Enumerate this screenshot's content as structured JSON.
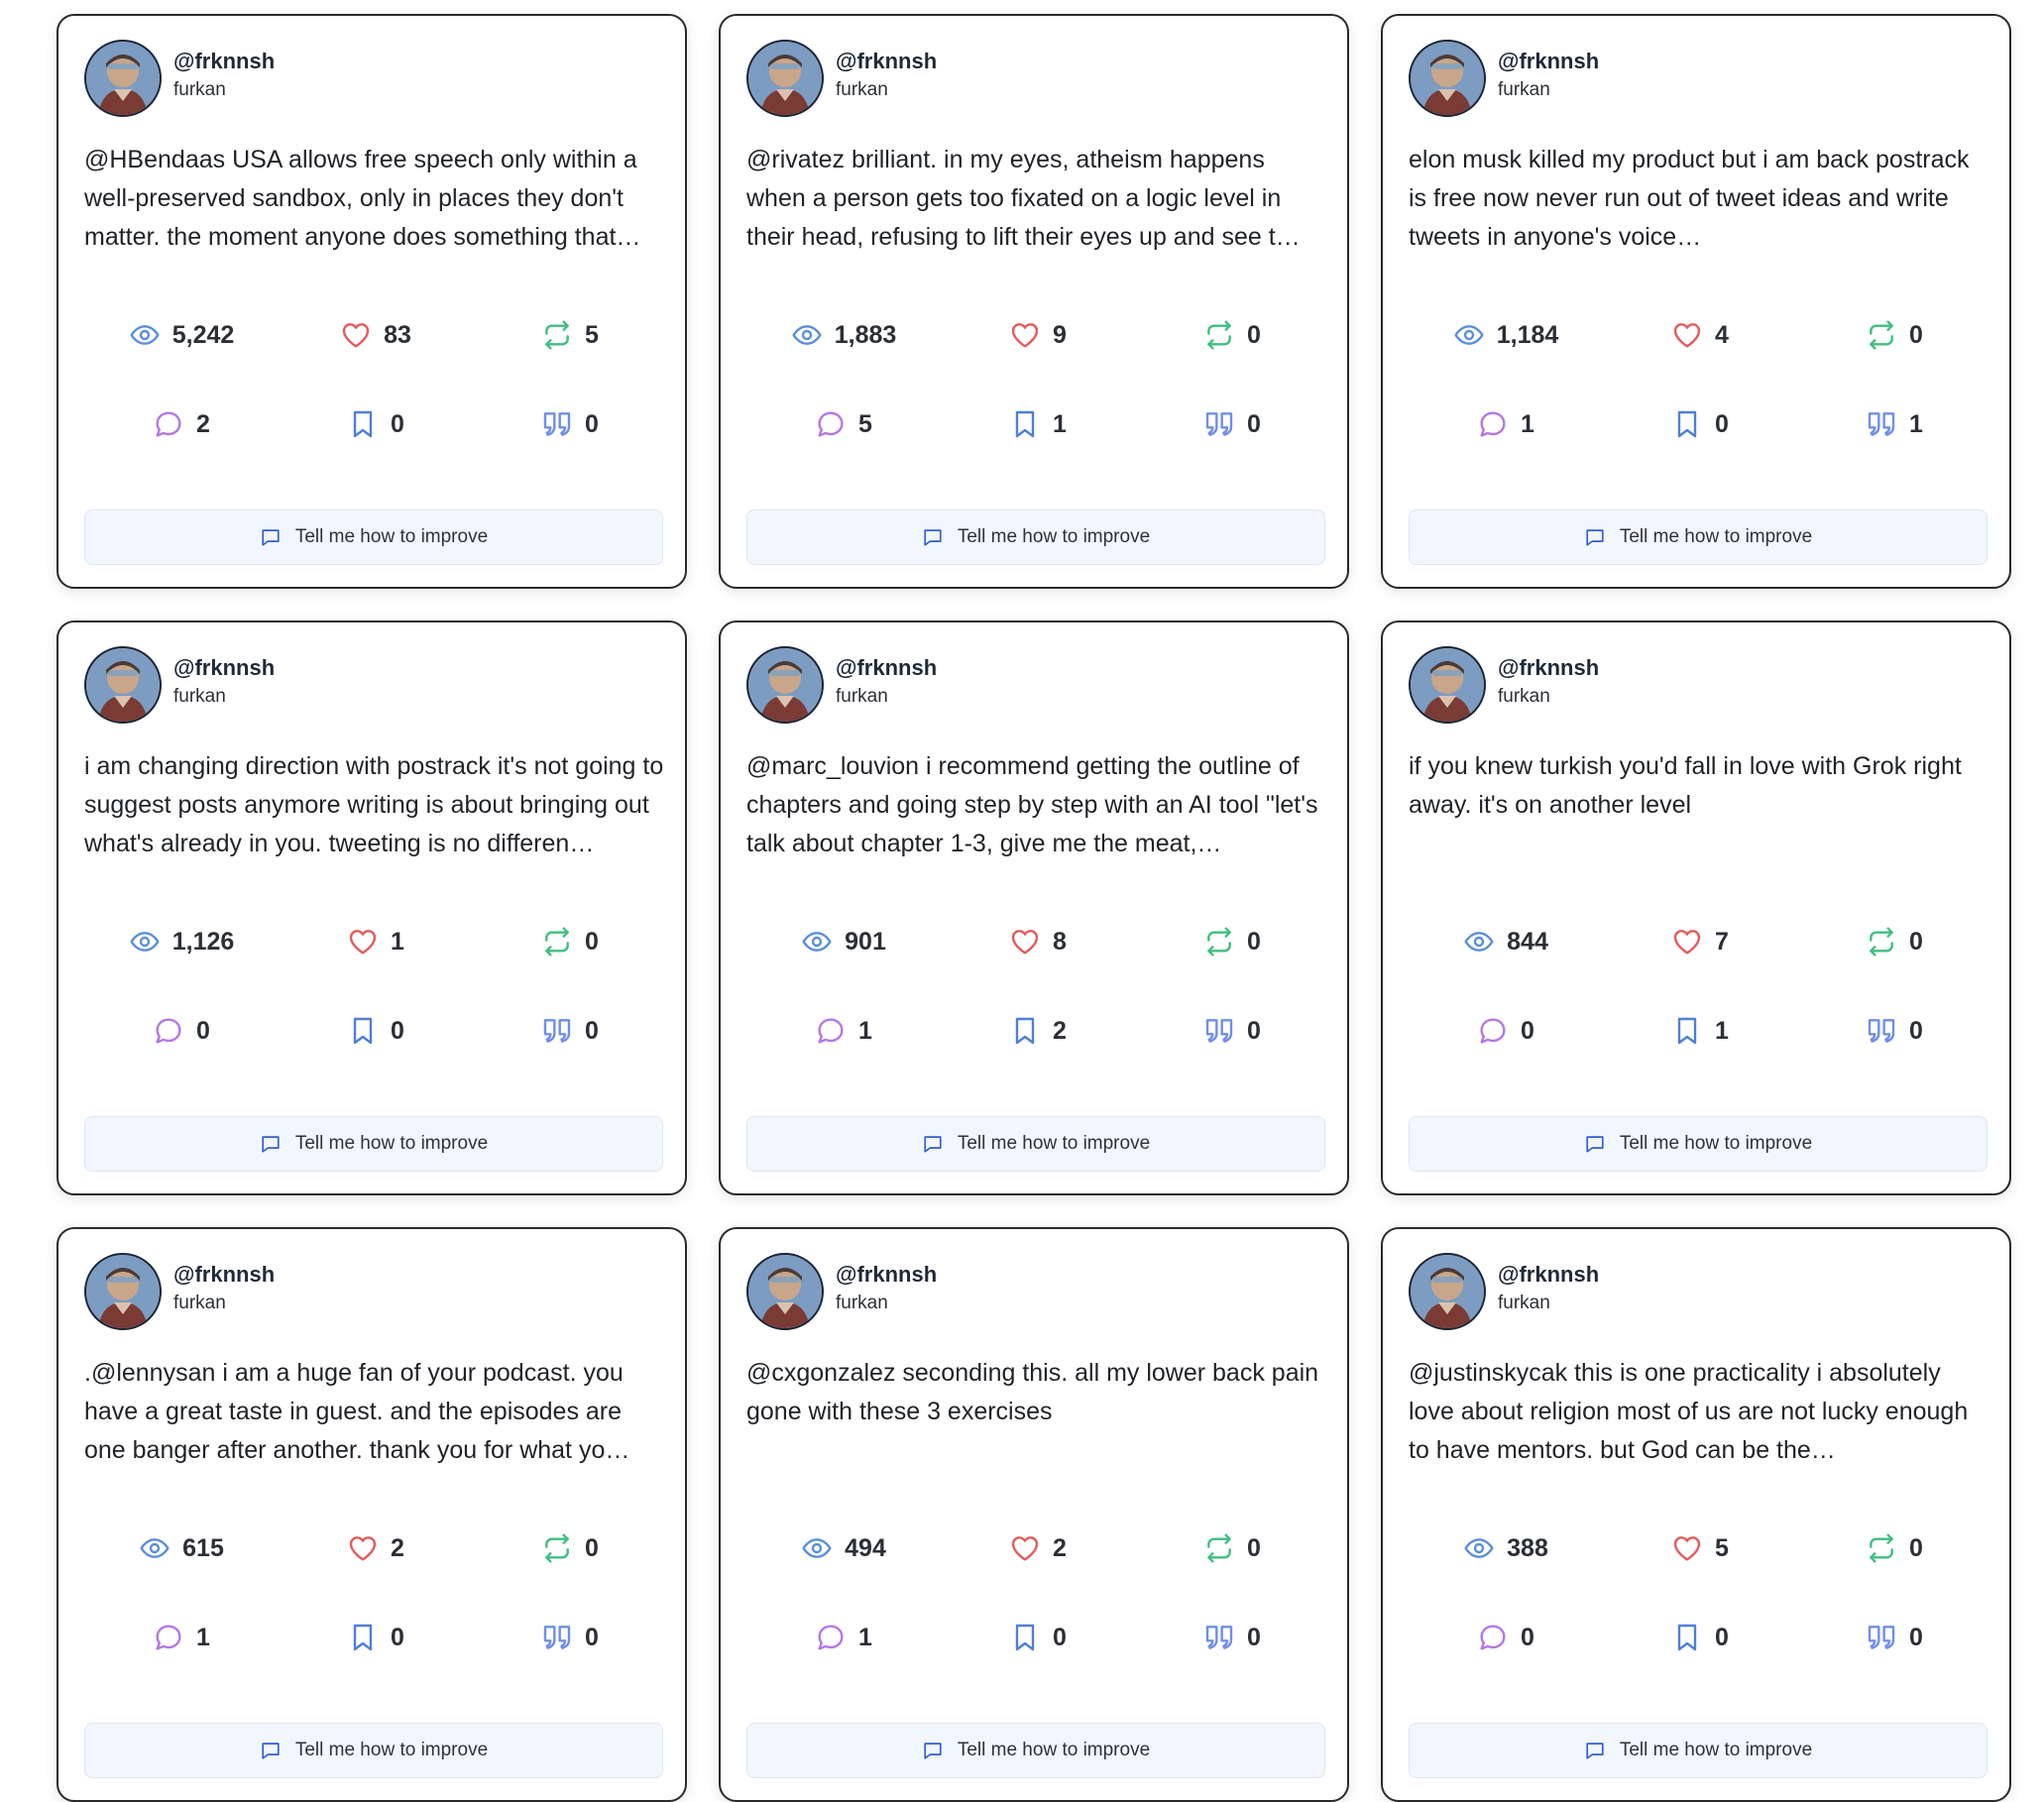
{
  "colors": {
    "views": "#5b8fd9",
    "likes": "#e35b5b",
    "reposts": "#3fbf7f",
    "replies": "#b577e6",
    "bookmarks": "#4f7fd9",
    "quotes": "#6f8ee6",
    "improve_bg": "#f2f6fe"
  },
  "icons": {
    "views": "eye-icon",
    "likes": "heart-icon",
    "reposts": "repost-icon",
    "replies": "reply-icon",
    "bookmarks": "bookmark-icon",
    "quotes": "quote-icon",
    "improve": "comment-icon"
  },
  "improve_label": "Tell me how to improve",
  "posts": [
    {
      "handle": "@frknnsh",
      "name": "furkan",
      "text": "@HBendaas USA allows free speech only within a well-preserved sandbox, only in places they don't matter. the moment anyone does something that…",
      "views": "5,242",
      "likes": "83",
      "reposts": "5",
      "replies": "2",
      "bookmarks": "0",
      "quotes": "0"
    },
    {
      "handle": "@frknnsh",
      "name": "furkan",
      "text": "@rivatez brilliant. in my eyes, atheism happens when a person gets too fixated on a logic level in their head, refusing to lift their eyes up and see t…",
      "views": "1,883",
      "likes": "9",
      "reposts": "0",
      "replies": "5",
      "bookmarks": "1",
      "quotes": "0"
    },
    {
      "handle": "@frknnsh",
      "name": "furkan",
      "text": "elon musk killed my product but i am back postrack is free now never run out of tweet ideas and write tweets in anyone's voice…",
      "views": "1,184",
      "likes": "4",
      "reposts": "0",
      "replies": "1",
      "bookmarks": "0",
      "quotes": "1"
    },
    {
      "handle": "@frknnsh",
      "name": "furkan",
      "text": "i am changing direction with postrack it's not going to suggest posts anymore writing is about bringing out what's already in you. tweeting is no differen…",
      "views": "1,126",
      "likes": "1",
      "reposts": "0",
      "replies": "0",
      "bookmarks": "0",
      "quotes": "0"
    },
    {
      "handle": "@frknnsh",
      "name": "furkan",
      "text": "@marc_louvion i recommend getting the outline of chapters and going step by step with an AI tool \"let's talk about chapter 1-3, give me the meat,…",
      "views": "901",
      "likes": "8",
      "reposts": "0",
      "replies": "1",
      "bookmarks": "2",
      "quotes": "0"
    },
    {
      "handle": "@frknnsh",
      "name": "furkan",
      "text": "if you knew turkish you'd fall in love with Grok right away. it's on another level",
      "views": "844",
      "likes": "7",
      "reposts": "0",
      "replies": "0",
      "bookmarks": "1",
      "quotes": "0"
    },
    {
      "handle": "@frknnsh",
      "name": "furkan",
      "text": ".@lennysan i am a huge fan of your podcast. you have a great taste in guest. and the episodes are one banger after another. thank you for what yo…",
      "views": "615",
      "likes": "2",
      "reposts": "0",
      "replies": "1",
      "bookmarks": "0",
      "quotes": "0"
    },
    {
      "handle": "@frknnsh",
      "name": "furkan",
      "text": "@cxgonzalez seconding this. all my lower back pain gone with these 3 exercises",
      "views": "494",
      "likes": "2",
      "reposts": "0",
      "replies": "1",
      "bookmarks": "0",
      "quotes": "0"
    },
    {
      "handle": "@frknnsh",
      "name": "furkan",
      "text": "@justinskycak this is one practicality i absolutely love about religion most of us are not lucky enough to have mentors. but God can be the…",
      "views": "388",
      "likes": "5",
      "reposts": "0",
      "replies": "0",
      "bookmarks": "0",
      "quotes": "0"
    }
  ]
}
